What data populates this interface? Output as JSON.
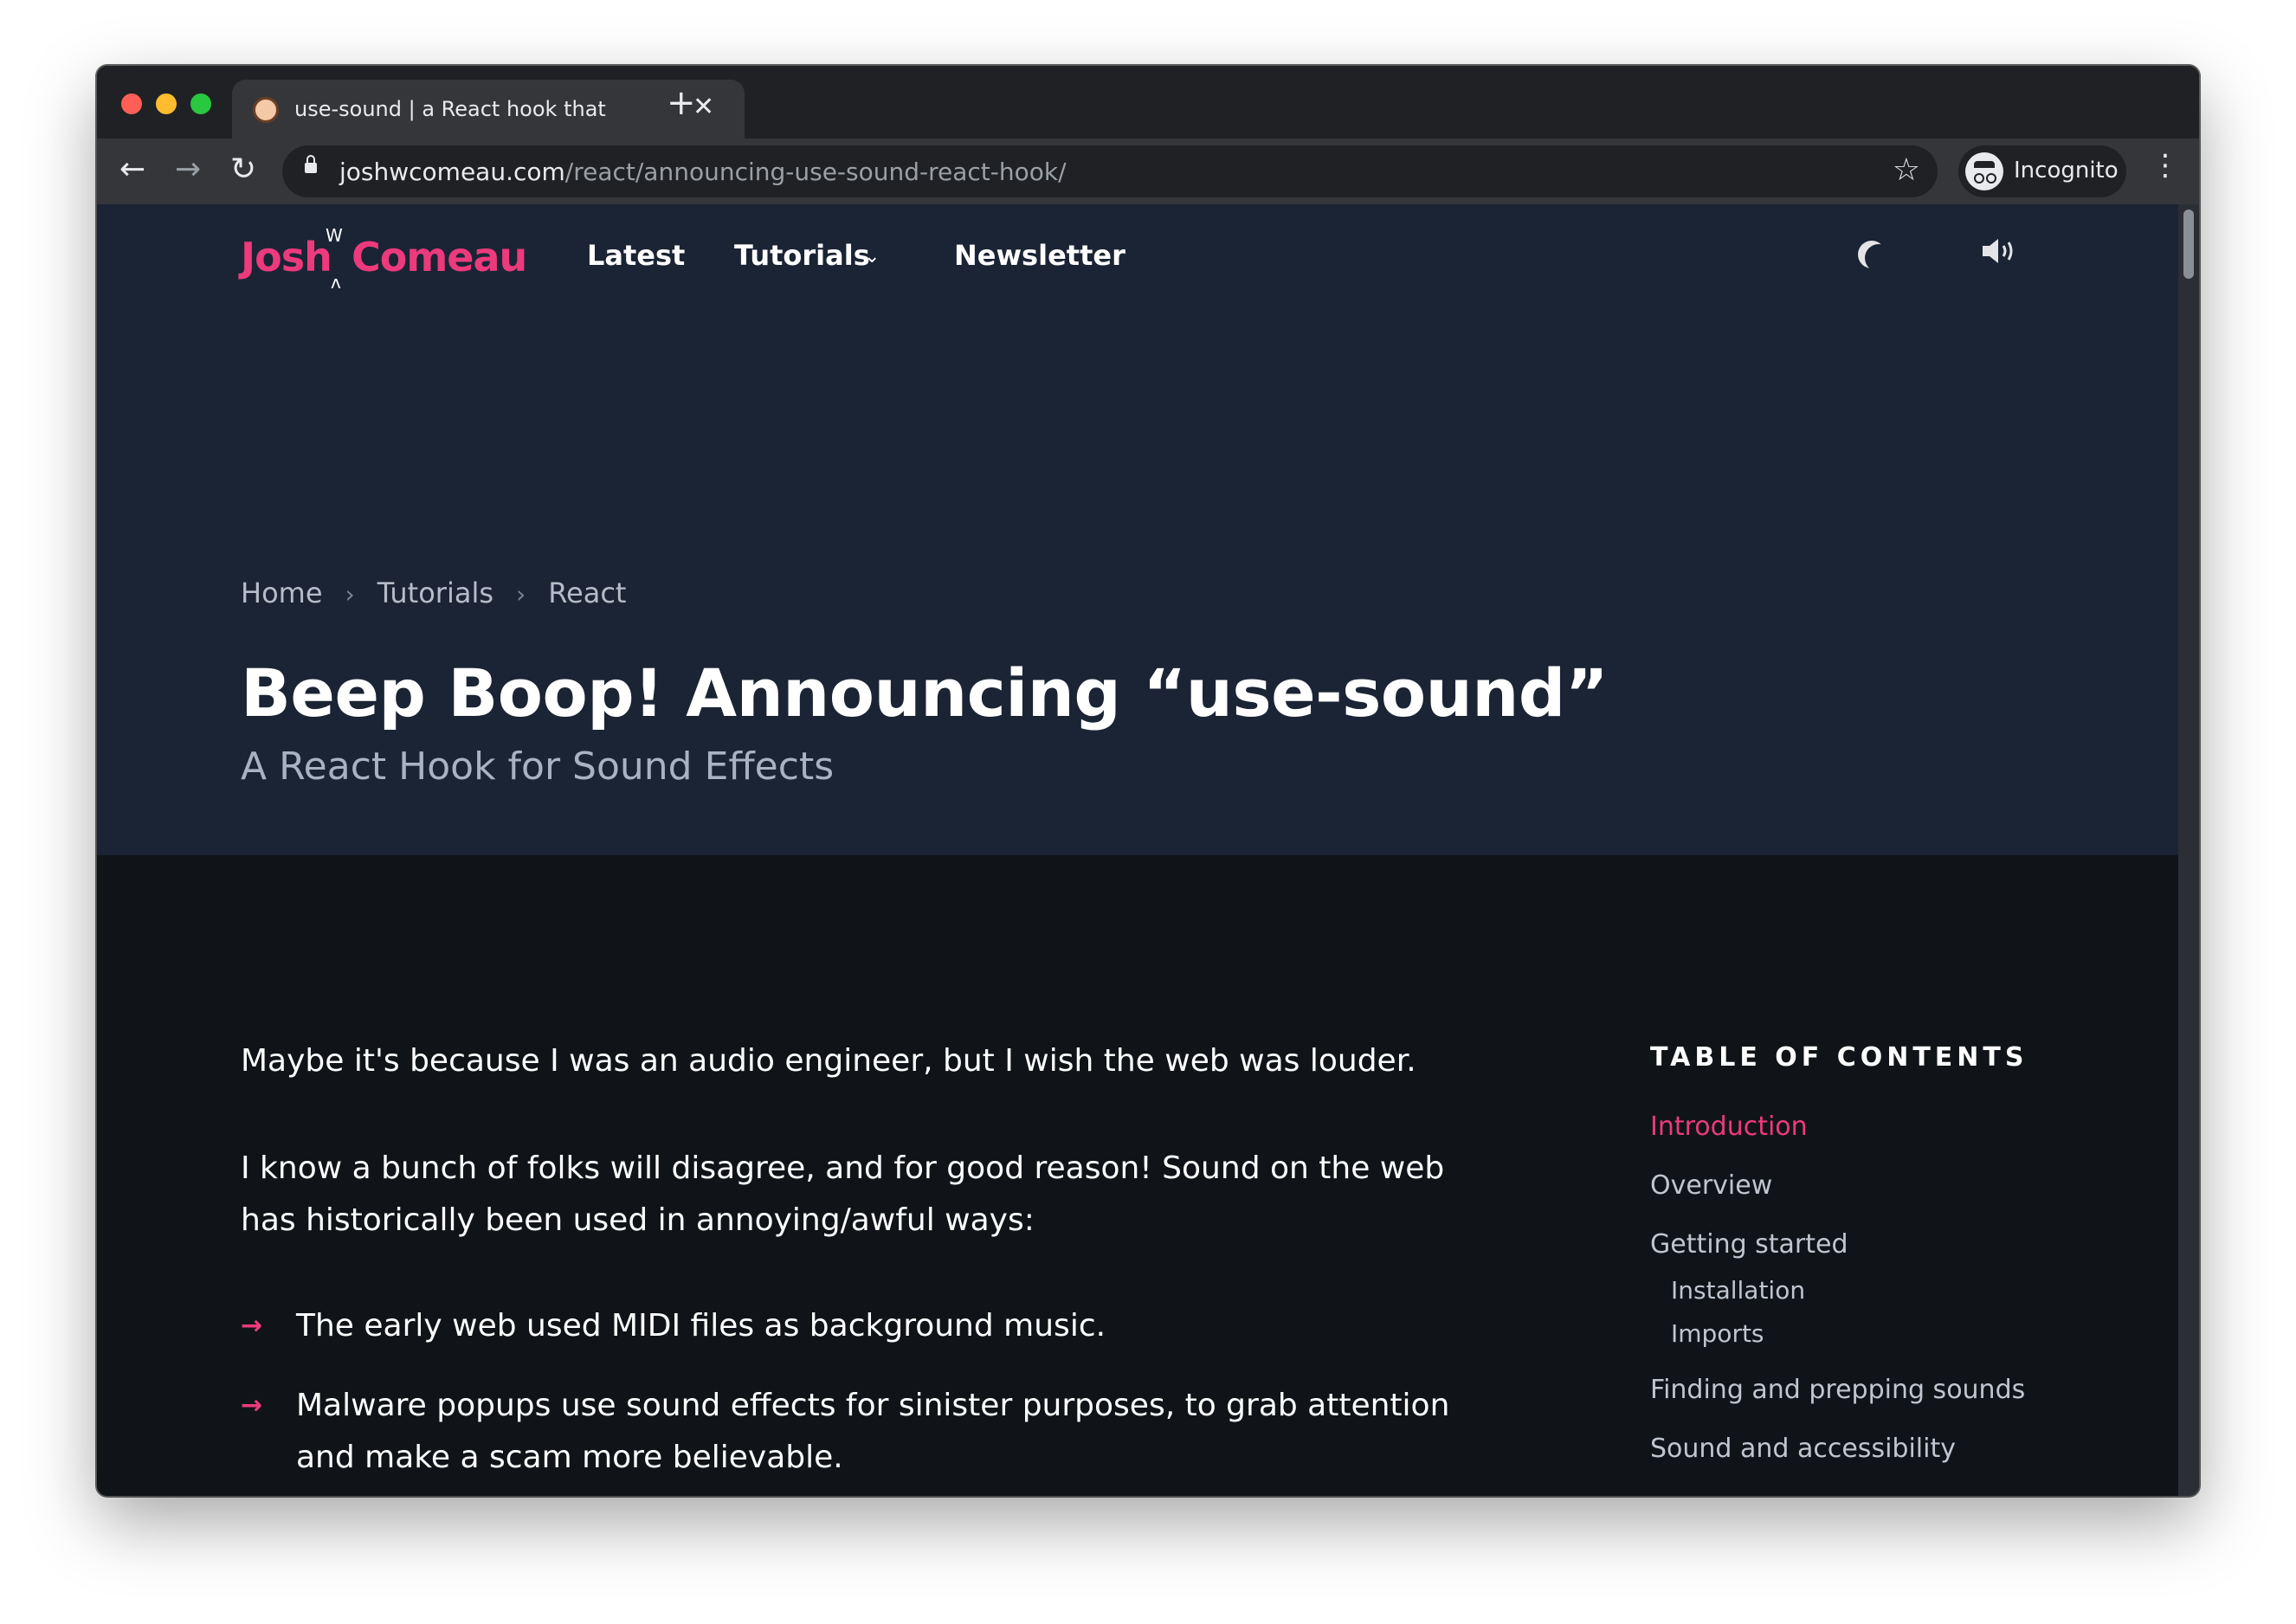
{
  "browser": {
    "tab_title": "use-sound | a React hook that",
    "tab_close": "✕",
    "new_tab": "+",
    "url_host": "joshwcomeau.com",
    "url_path": "/react/announcing-use-sound-react-hook/",
    "profile_label": "Incognito",
    "back_icon": "←",
    "forward_icon": "→",
    "reload_icon": "↻",
    "star_icon": "☆",
    "menu_icon": "⋮"
  },
  "site": {
    "logo_first": "Josh",
    "logo_last": "Comeau",
    "logo_mark_top": "W",
    "logo_mark_bottom": "ʌ",
    "nav": {
      "latest": "Latest",
      "tutorials": "Tutorials",
      "tutorials_chevron": "⌄",
      "newsletter": "Newsletter"
    },
    "sound_icon": "🔈︎)",
    "accent_color": "#ec3a7c"
  },
  "hero": {
    "breadcrumb": [
      "Home",
      "Tutorials",
      "React"
    ],
    "breadcrumb_sep": "›",
    "title": "Beep Boop! Announcing “use-sound”",
    "subtitle": "A React Hook for Sound Effects"
  },
  "article": {
    "paragraphs": [
      "Maybe it's because I was an audio engineer, but I wish the web was louder.",
      "I know a bunch of folks will disagree, and for good reason! Sound on the web has historically been used in annoying/awful ways:"
    ],
    "bullet_arrow": "→",
    "bullets": [
      "The early web used MIDI files as background music.",
      "Malware popups use sound effects for sinister purposes, to grab attention and make a scam more believable."
    ]
  },
  "toc": {
    "heading": "TABLE OF CONTENTS",
    "items": [
      {
        "label": "Introduction"
      },
      {
        "label": "Overview"
      },
      {
        "label": "Getting started"
      },
      {
        "label": "Installation"
      },
      {
        "label": "Imports"
      },
      {
        "label": "Finding and prepping sounds"
      },
      {
        "label": "Sound and accessibility"
      }
    ]
  }
}
